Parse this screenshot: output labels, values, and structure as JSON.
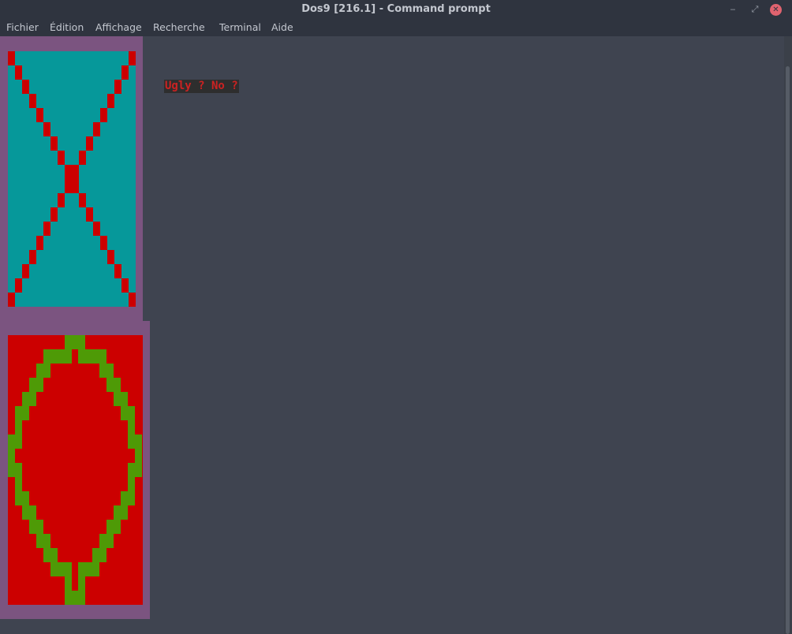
{
  "window": {
    "title": "Dos9 [216.1] - Command prompt",
    "controls": {
      "minimize": "‒",
      "maximize": "⤢",
      "close": "✕"
    }
  },
  "menu": {
    "items": [
      "Fichier",
      "Édition",
      "Affichage",
      "Recherche",
      "Terminal",
      "Aide"
    ]
  },
  "terminal": {
    "output_text": "Ugly ? No ?",
    "colors": {
      "background": "#3f4450",
      "text_red": "#cc2222",
      "text_bg": "#2e2e2e",
      "border_purple": "#7b5480",
      "cyan": "#06989a",
      "red": "#cc0000",
      "green": "#4e9a06"
    }
  }
}
